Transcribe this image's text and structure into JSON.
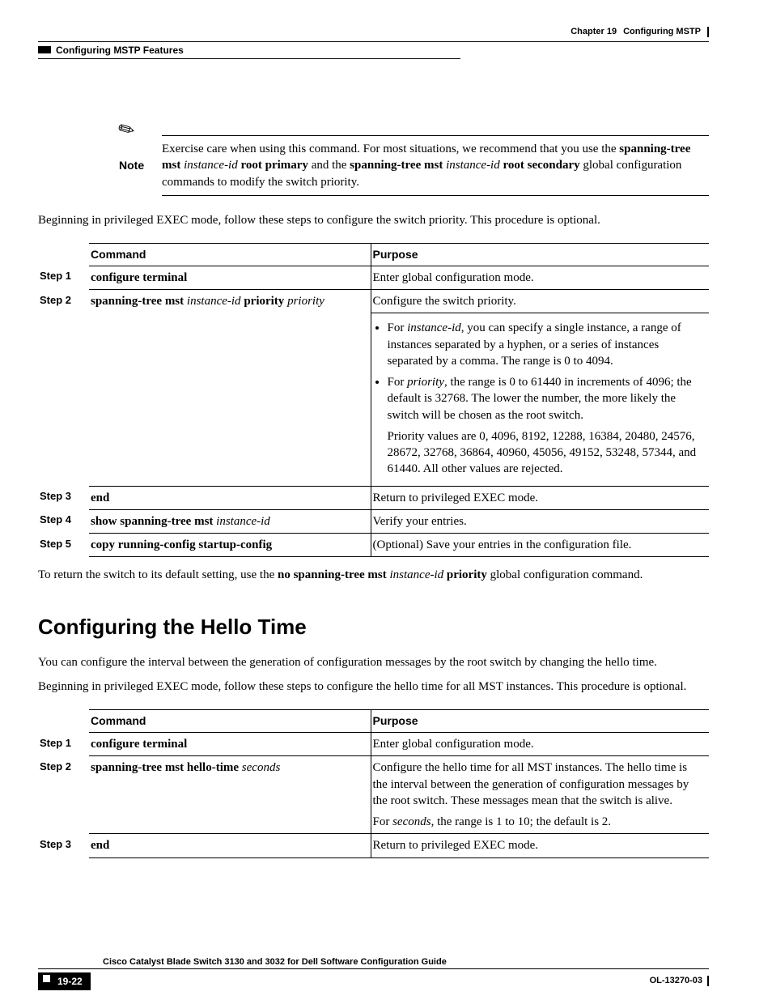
{
  "header": {
    "section": "Configuring MSTP Features",
    "chapter_prefix": "Chapter 19",
    "chapter_title": "Configuring MSTP"
  },
  "note": {
    "label": "Note",
    "p1a": "Exercise care when using this command. For most situations, we recommend that you use the ",
    "p1b": "spanning-tree mst",
    "p1c": "instance-id",
    "p1d": "root primary",
    "p1e": " and the ",
    "p1f": "spanning-tree mst",
    "p1g": "instance-id",
    "p1h": "root secondary",
    "p1i": " global configuration commands to modify the switch priority."
  },
  "intro1": "Beginning in privileged EXEC mode, follow these steps to configure the switch priority. This procedure is optional.",
  "t1": {
    "h_cmd": "Command",
    "h_purpose": "Purpose",
    "s1": "Step 1",
    "s1_c": "configure terminal",
    "s1_p": "Enter global configuration mode.",
    "s2": "Step 2",
    "s2_c1": "spanning-tree mst",
    "s2_c2": "instance-id",
    "s2_c3": "priority",
    "s2_c4": "priority",
    "s2_p1": "Configure the switch priority.",
    "s2_li1a": "For ",
    "s2_li1b": "instance-id",
    "s2_li1c": ", you can specify a single instance, a range of instances separated by a hyphen, or a series of instances separated by a comma. The range is 0 to 4094.",
    "s2_li2a": "For ",
    "s2_li2b": "priority",
    "s2_li2c": ", the range is 0 to 61440 in increments of 4096; the default is 32768. The lower the number, the more likely the switch will be chosen as the root switch.",
    "s2_li2d": "Priority values are 0, 4096, 8192, 12288, 16384, 20480, 24576, 28672, 32768, 36864, 40960, 45056, 49152, 53248, 57344, and 61440. All other values are rejected.",
    "s3": "Step 3",
    "s3_c": "end",
    "s3_p": "Return to privileged EXEC mode.",
    "s4": "Step 4",
    "s4_c1": "show spanning-tree mst",
    "s4_c2": "instance-id",
    "s4_p": "Verify your entries.",
    "s5": "Step 5",
    "s5_c": "copy running-config startup-config",
    "s5_p": "(Optional) Save your entries in the configuration file."
  },
  "after1a": "To return the switch to its default setting, use the ",
  "after1b": "no spanning-tree mst",
  "after1c": "instance-id",
  "after1d": "priority",
  "after1e": " global configuration command.",
  "h2": "Configuring the Hello Time",
  "intro2a": "You can configure the interval between the generation of configuration messages by the root switch by changing the hello time.",
  "intro2b": "Beginning in privileged EXEC mode, follow these steps to configure the hello time for all MST instances. This procedure is optional.",
  "t2": {
    "h_cmd": "Command",
    "h_purpose": "Purpose",
    "s1": "Step 1",
    "s1_c": "configure terminal",
    "s1_p": "Enter global configuration mode.",
    "s2": "Step 2",
    "s2_c1": "spanning-tree mst hello-time",
    "s2_c2": "seconds",
    "s2_p1": "Configure the hello time for all MST instances. The hello time is the interval between the generation of configuration messages by the root switch. These messages mean that the switch is alive.",
    "s2_p2a": "For ",
    "s2_p2b": "seconds",
    "s2_p2c": ", the range is 1 to 10; the default is 2.",
    "s3": "Step 3",
    "s3_c": "end",
    "s3_p": "Return to privileged EXEC mode."
  },
  "footer": {
    "book": "Cisco Catalyst Blade Switch 3130 and 3032 for Dell Software Configuration Guide",
    "page": "19-22",
    "doc": "OL-13270-03"
  }
}
